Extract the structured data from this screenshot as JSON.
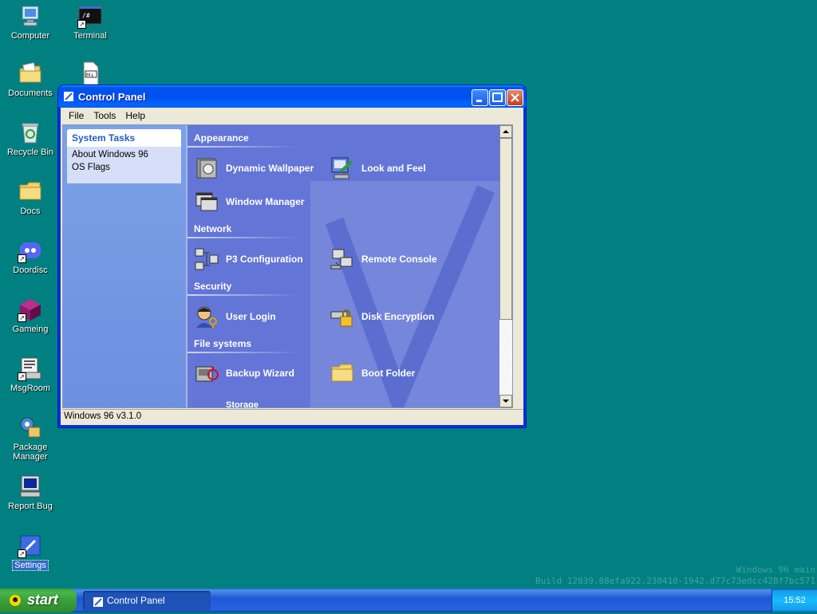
{
  "desktop": {
    "icons": [
      {
        "label": "Computer",
        "name": "computer"
      },
      {
        "label": "Terminal",
        "name": "terminal"
      },
      {
        "label": "Documents",
        "name": "documents"
      },
      {
        "label": "Recycle Bin",
        "name": "recycle-bin"
      },
      {
        "label": "Docs",
        "name": "docs"
      },
      {
        "label": "Doordisc",
        "name": "doordisc"
      },
      {
        "label": "Gameing",
        "name": "gameing"
      },
      {
        "label": "MsgRoom",
        "name": "msgroom"
      },
      {
        "label": "Package Manager",
        "name": "package-manager"
      },
      {
        "label": "Report Bug",
        "name": "report-bug"
      },
      {
        "label": "Settings",
        "name": "settings"
      }
    ],
    "md_file_label": "M↓",
    "build_line1": "Windows 96 main",
    "build_line2": "Build 12839.88efa922.230410-1942.d77c73edcc428f7bc571"
  },
  "window": {
    "title": "Control Panel",
    "menu": [
      "File",
      "Tools",
      "Help"
    ],
    "status": "Windows 96 v3.1.0",
    "tasks": {
      "header": "System Tasks",
      "items": [
        "About Windows 96",
        "OS Flags"
      ]
    },
    "sections": {
      "appearance": "Appearance",
      "network": "Network",
      "security": "Security",
      "filesystems": "File systems",
      "storage": "Storage"
    },
    "applets": {
      "dynamic_wallpaper": "Dynamic Wallpaper",
      "look_and_feel": "Look and Feel",
      "window_manager": "Window Manager",
      "p3_configuration": "P3 Configuration",
      "remote_console": "Remote Console",
      "user_login": "User Login",
      "disk_encryption": "Disk Encryption",
      "backup_wizard": "Backup Wizard",
      "boot_folder": "Boot Folder"
    }
  },
  "taskbar": {
    "start_label": "start",
    "task_button": "Control Panel",
    "clock": "15:52"
  },
  "colors": {
    "desktop": "#008080",
    "title_blue": "#0054e3",
    "content_blue": "#6375d6",
    "start_green": "#3c9a3c"
  }
}
